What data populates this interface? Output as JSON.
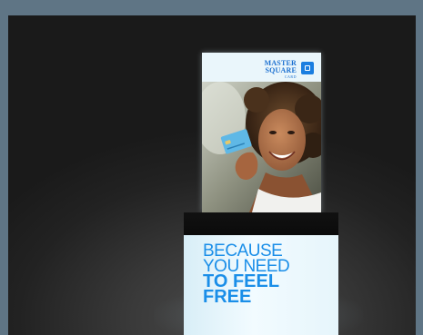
{
  "poster": {
    "logo": {
      "line1": "MASTER",
      "line2": "SQUARE",
      "line3": "CARD"
    }
  },
  "stand": {
    "tagline": {
      "line1": "BECAUSE",
      "line2": "YOU NEED",
      "line3": "TO FEEL",
      "line4": "FREE"
    }
  },
  "colors": {
    "brand_blue": "#1a8ee8",
    "light_panel": "#eaf6fb",
    "backdrop": "#2a2a2a",
    "frame": "#5f7585"
  }
}
